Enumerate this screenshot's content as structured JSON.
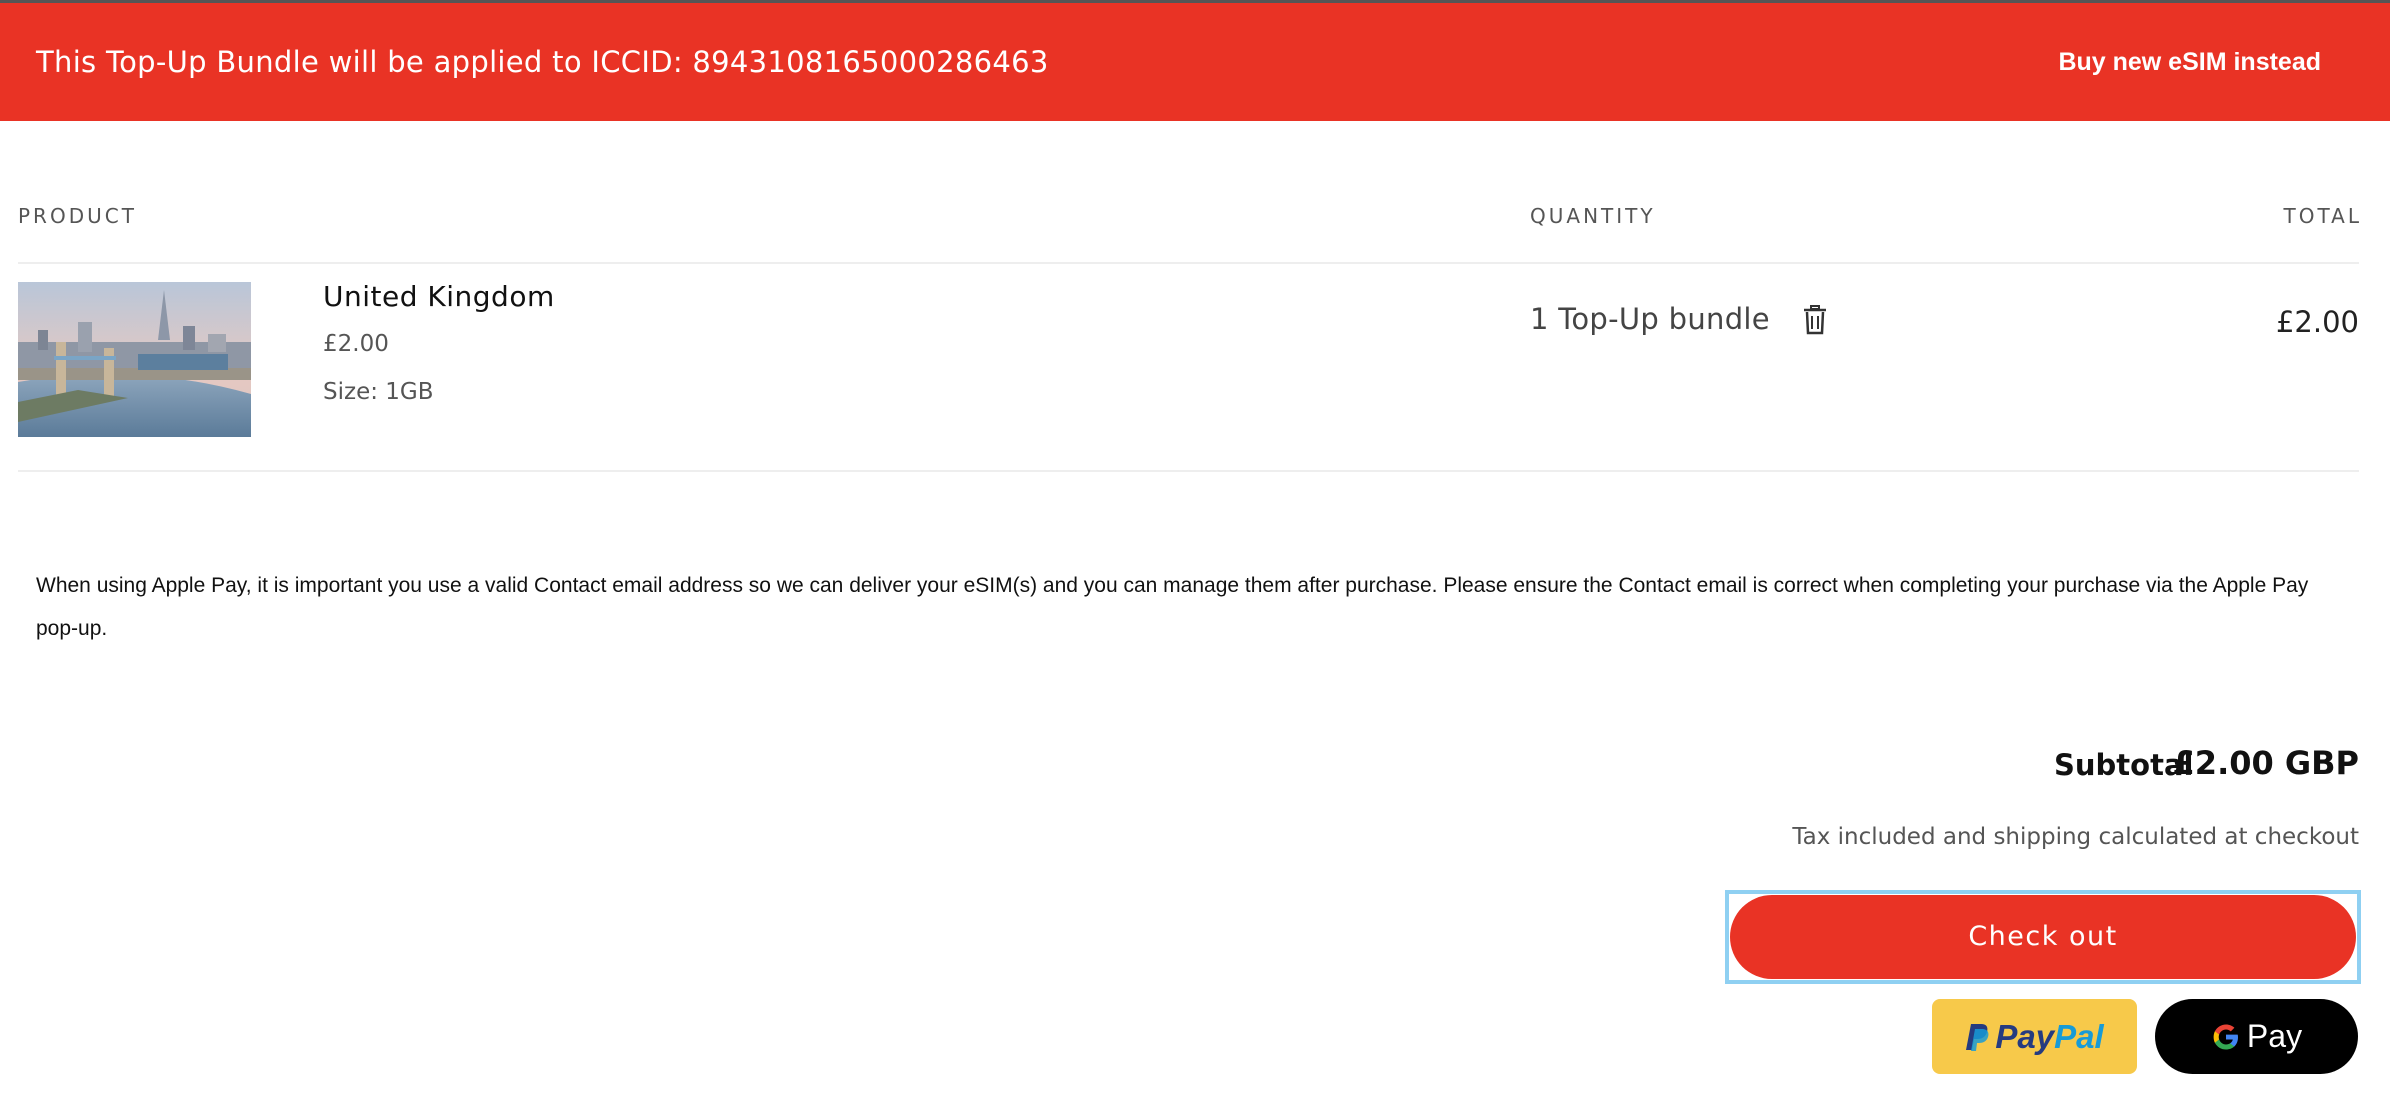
{
  "banner": {
    "message": "This Top-Up Bundle will be applied to ICCID: 8943108165000286463",
    "link_label": "Buy new eSIM instead"
  },
  "cart": {
    "headers": {
      "product": "PRODUCT",
      "quantity": "QUANTITY",
      "total": "TOTAL"
    },
    "items": [
      {
        "title": "United Kingdom",
        "price": "£2.00",
        "size": "Size: 1GB",
        "quantity": "1 Top-Up bundle",
        "total": "£2.00",
        "image_icon": "london-tower-bridge-photo"
      }
    ]
  },
  "notice": "When using Apple Pay, it is important you use a valid Contact email address so we can deliver your eSIM(s) and you can manage them after purchase. Please ensure the Contact email is correct when completing your purchase via the Apple Pay pop-up.",
  "summary": {
    "subtotal_label": "Subtotal",
    "subtotal_value": "£2.00 GBP",
    "tax_note": "Tax included and shipping calculated at checkout"
  },
  "actions": {
    "checkout_label": "Check out",
    "paypal_part1": "Pay",
    "paypal_part2": "Pal",
    "gpay_label": "Pay"
  },
  "colors": {
    "accent": "#e93325",
    "paypal_bg": "#f7c94a",
    "focus_ring": "#8fd0f2"
  }
}
